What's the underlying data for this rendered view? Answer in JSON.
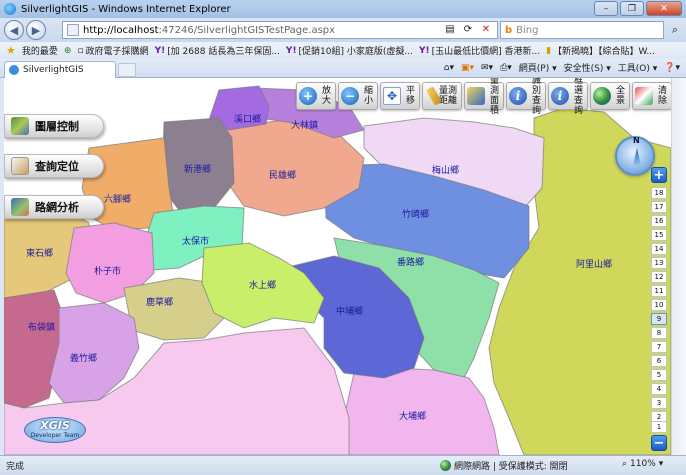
{
  "window": {
    "title": "SilverlightGIS - Windows Internet Explorer",
    "controls": [
      "–",
      "❐",
      "✕"
    ]
  },
  "address": {
    "url_host": "http://localhost",
    "url_rest": ":47246/SilverlightGISTestPage.aspx",
    "search_placeholder": "Bing"
  },
  "favorites": {
    "label": "我的最愛",
    "items": [
      "政府電子採購網",
      "[加 2688 話長為三年保固...",
      "[促銷10組] 小家庭版(虛擬...",
      "[玉山最低比價網] 香港新...",
      "【新揭曉】【綜合貼】W..."
    ]
  },
  "tab": {
    "label": "SilverlightGIS"
  },
  "commands": {
    "page": "網頁(P) ▾",
    "safety": "安全性(S) ▾",
    "tools": "工具(O) ▾",
    "help": "❓▾"
  },
  "side_panel": {
    "layers": "圖層控制",
    "query": "查詢定位",
    "route": "路網分析"
  },
  "toolbar": {
    "zoom_in": "放大",
    "zoom_out": "縮小",
    "pan": "平移",
    "measure_distance": "量測距離",
    "measure_area": "量測面積",
    "identify": "識別查詢",
    "box_query": "框選查詢",
    "full_extent": "全景",
    "clear": "清除"
  },
  "compass": {
    "north": "N"
  },
  "zoom": {
    "plus": "+",
    "minus": "−",
    "levels": [
      "18",
      "17",
      "16",
      "15",
      "14",
      "13",
      "12",
      "11",
      "10",
      "9",
      "8",
      "7",
      "6",
      "5",
      "4",
      "3",
      "2",
      "1"
    ],
    "active_level": "9"
  },
  "map": {
    "townships": [
      "溪口鄉",
      "大林鎮",
      "新港鄉",
      "民雄鄉",
      "梅山鄉",
      "六腳鄉",
      "竹崎鄉",
      "太保市",
      "東石鄉",
      "朴子市",
      "番路鄉",
      "阿里山鄉",
      "水上鄉",
      "鹿草鄉",
      "中埔鄉",
      "布袋鎮",
      "義竹鄉",
      "大埔鄉"
    ]
  },
  "logo": {
    "name": "XGIS",
    "team": "Developer Team"
  },
  "status": {
    "done": "完成",
    "zone": "網際網路 | 受保護模式: 開閉",
    "zoom": "110%"
  },
  "colors": {
    "titlebar": "#b9d1ee",
    "accent": "#1b5fb8"
  }
}
